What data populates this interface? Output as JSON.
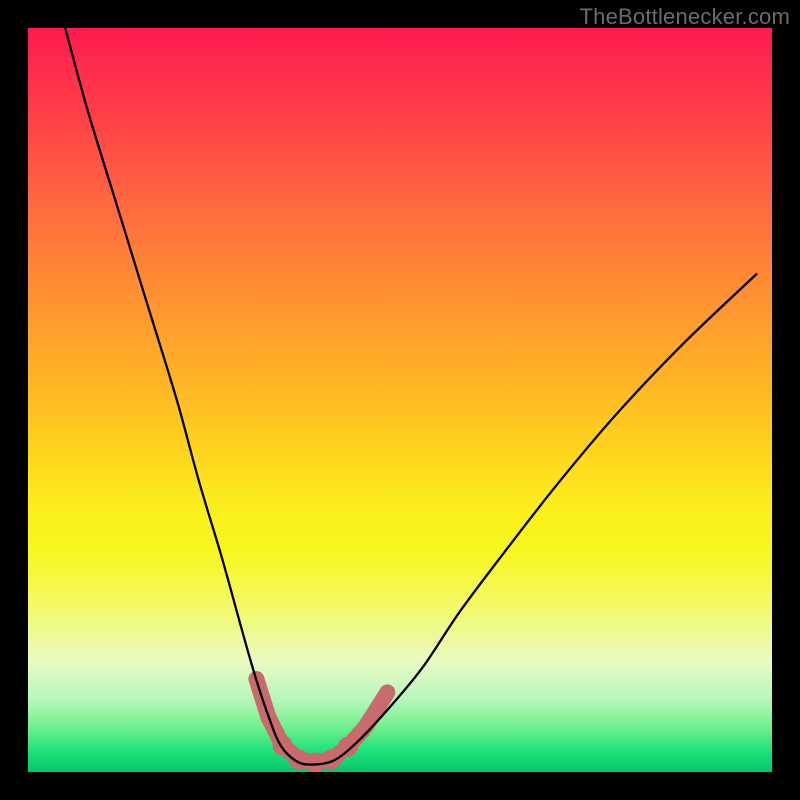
{
  "watermark": "TheBottlenecker.com",
  "chart_data": {
    "type": "line",
    "title": "",
    "xlabel": "",
    "ylabel": "",
    "xlim": [
      0,
      100
    ],
    "ylim": [
      0,
      100
    ],
    "gradient_stops": [
      {
        "pct": 0,
        "color": "#ff1a50"
      },
      {
        "pct": 14,
        "color": "#ff4747"
      },
      {
        "pct": 34,
        "color": "#ff8b34"
      },
      {
        "pct": 56,
        "color": "#ffd21e"
      },
      {
        "pct": 70,
        "color": "#f7f71e"
      },
      {
        "pct": 85,
        "color": "#e9fbc2"
      },
      {
        "pct": 94,
        "color": "#6ff08e"
      },
      {
        "pct": 100,
        "color": "#04c86c"
      }
    ],
    "series": [
      {
        "name": "bottleneck-curve",
        "stroke": "#000000",
        "x": [
          5,
          8,
          12,
          16,
          20,
          23,
          26,
          28.5,
          30.5,
          32.5,
          34,
          36,
          38,
          41,
          44,
          48,
          53,
          58,
          64,
          71,
          79,
          88,
          98
        ],
        "values": [
          100,
          89,
          76,
          63,
          50,
          39,
          29,
          20,
          13,
          7,
          3.5,
          1.5,
          1,
          1.5,
          3.8,
          8,
          14,
          21.5,
          29.5,
          38.5,
          48,
          57.5,
          67
        ]
      }
    ],
    "markers": {
      "name": "trough-markers",
      "stroke": "#c86a6e",
      "fill": "#c86a6e",
      "points": [
        {
          "x": 30.7,
          "y": 12.5,
          "r": 7
        },
        {
          "x": 32.3,
          "y": 7.4,
          "r": 8
        },
        {
          "x": 34.2,
          "y": 3.6,
          "r": 10
        },
        {
          "x": 36.4,
          "y": 1.7,
          "r": 10
        },
        {
          "x": 38.6,
          "y": 1.3,
          "r": 10
        },
        {
          "x": 40.8,
          "y": 1.7,
          "r": 10
        },
        {
          "x": 43.0,
          "y": 3.4,
          "r": 10
        },
        {
          "x": 45.3,
          "y": 6.0,
          "r": 7
        },
        {
          "x": 46.6,
          "y": 8.0,
          "r": 7
        },
        {
          "x": 48.3,
          "y": 10.7,
          "r": 7
        }
      ]
    }
  }
}
